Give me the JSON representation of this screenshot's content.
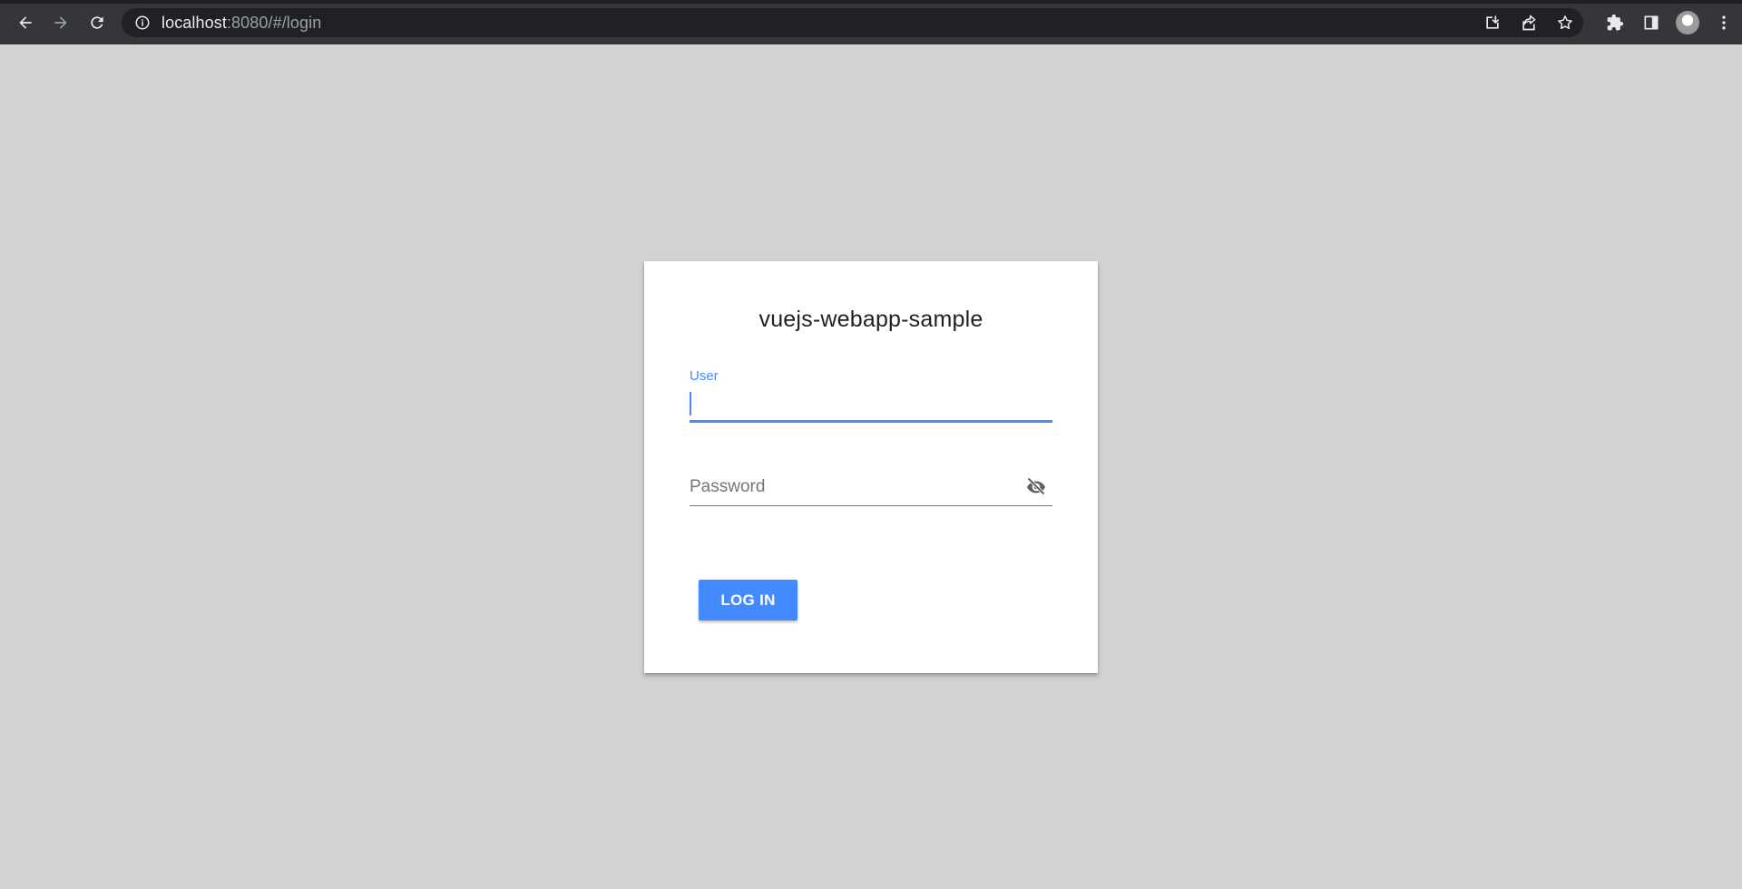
{
  "browser": {
    "url_host": "localhost",
    "url_rest": ":8080/#/login",
    "icons": {
      "back": "arrow-left-icon",
      "forward": "arrow-right-icon",
      "reload": "reload-icon",
      "info": "info-icon",
      "install": "install-app-icon",
      "share": "share-icon",
      "bookmark": "star-icon",
      "extensions": "puzzle-icon",
      "side_panel": "side-panel-icon",
      "profile": "avatar",
      "menu": "kebab-menu-icon"
    }
  },
  "login": {
    "title": "vuejs-webapp-sample",
    "user_label": "User",
    "user_value": "",
    "password_placeholder": "Password",
    "password_value": "",
    "password_toggle_icon": "eye-off-icon",
    "submit_label": "LOG IN"
  },
  "colors": {
    "accent": "#448aff",
    "page_background": "#d3d3d3",
    "browser_bar": "#35363a"
  }
}
